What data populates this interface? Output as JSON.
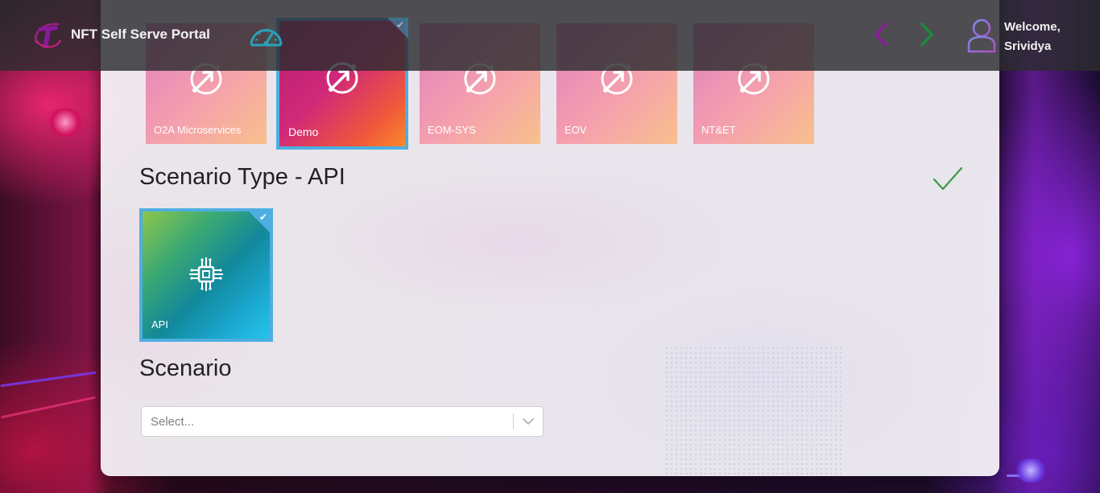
{
  "header": {
    "title": "NFT Self Serve Portal",
    "logo": "telstra-t-logo",
    "gauge_icon": "dashboard-gauge-icon",
    "prev_icon": "chevron-left-icon",
    "next_icon": "chevron-right-icon",
    "avatar_icon": "user-icon",
    "welcome_line1": "Welcome,",
    "welcome_line2": "Srividya"
  },
  "applications": {
    "selected_index": 1,
    "tiles": [
      {
        "label": "O2A Microservices",
        "icon": "orbit-arrow-icon"
      },
      {
        "label": "Demo",
        "icon": "orbit-arrow-icon"
      },
      {
        "label": "EOM-SYS",
        "icon": "orbit-arrow-icon"
      },
      {
        "label": "EOV",
        "icon": "orbit-arrow-icon"
      },
      {
        "label": "NT&ET",
        "icon": "orbit-arrow-icon"
      }
    ]
  },
  "scenario_type": {
    "title": "Scenario Type - API",
    "completed_icon": "checkmark-icon",
    "tiles": [
      {
        "label": "API",
        "icon": "circuit-chip-icon",
        "selected": true
      }
    ]
  },
  "scenario": {
    "title": "Scenario",
    "select_placeholder": "Select..."
  },
  "colors": {
    "accent_blue": "#4eaee0",
    "check_green": "#3a9a4a",
    "prev_arrow": "#8a1a9a",
    "next_arrow": "#1a8a3a"
  }
}
